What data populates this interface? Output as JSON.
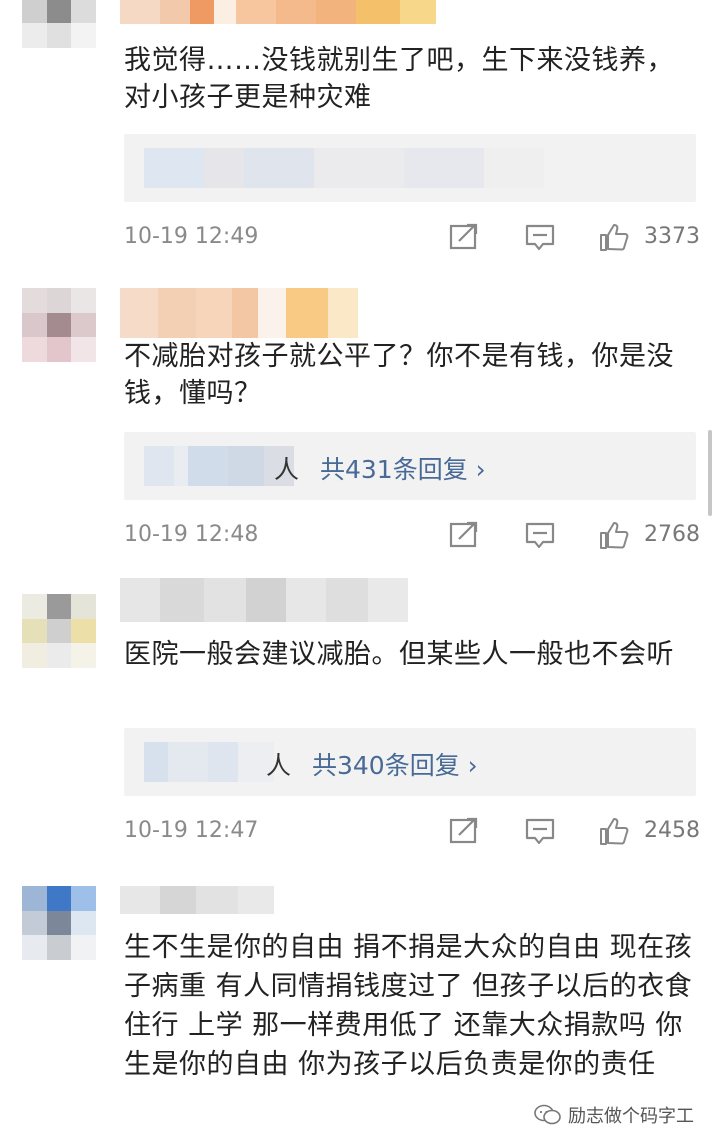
{
  "comments": [
    {
      "text": "我觉得……没钱就别生了吧，生下来没钱养，对小孩子更是种灾难",
      "time": "10-19 12:49",
      "likes": "3373",
      "reply_people": "",
      "reply_count": ""
    },
    {
      "text": "不减胎对孩子就公平了？你不是有钱，你是没钱，懂吗？",
      "time": "10-19 12:48",
      "likes": "2768",
      "reply_people": "人",
      "reply_count": "共431条回复 ›"
    },
    {
      "text": "医院一般会建议减胎。但某些人一般也不会听",
      "time": "10-19 12:47",
      "likes": "2458",
      "reply_people": "人",
      "reply_count": "共340条回复 ›"
    },
    {
      "text": "生不生是你的自由 捐不捐是大众的自由 现在孩子病重 有人同情捐钱度过了 但孩子以后的衣食住行 上学 那一样费用低了 还靠大众捐款吗 你生是你的自由 你为孩子以后负责是你的责任",
      "time": "",
      "likes": "",
      "reply_people": "",
      "reply_count": ""
    }
  ],
  "watermark": {
    "text": "励志做个码字工",
    "icon": "wechat-icon"
  },
  "icons": {
    "share": "share-icon",
    "comment": "comment-icon",
    "like": "thumbs-up-icon"
  },
  "colors": {
    "link": "#486a96",
    "meta": "#8a8a8a",
    "reply_bg": "#f2f2f2"
  }
}
